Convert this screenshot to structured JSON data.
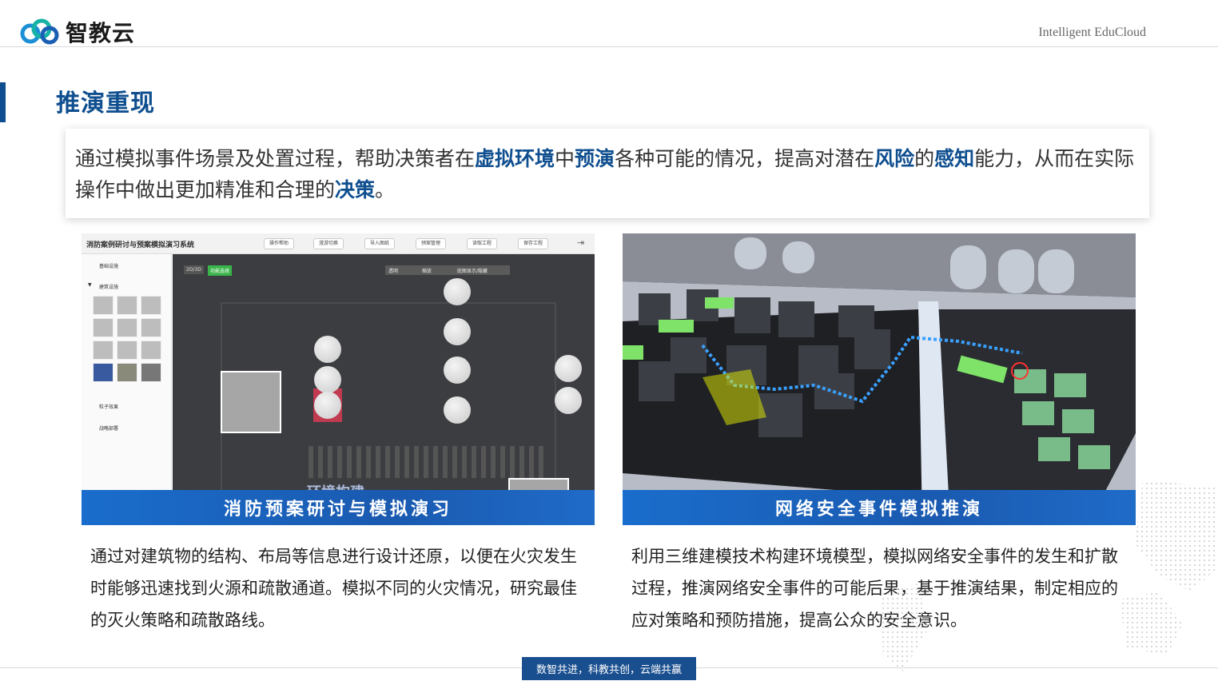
{
  "header": {
    "logo_text": "智教云",
    "tagline": "Intelligent EduCloud"
  },
  "page": {
    "title": "推演重现"
  },
  "summary": {
    "segments": [
      {
        "text": "通过模拟事件场景及处置过程，帮助决策者在",
        "bold": false
      },
      {
        "text": "虚拟环境",
        "bold": true
      },
      {
        "text": "中",
        "bold": false
      },
      {
        "text": "预演",
        "bold": true
      },
      {
        "text": "各种可能的情况，提高对潜在",
        "bold": false
      },
      {
        "text": "风险",
        "bold": true
      },
      {
        "text": "的",
        "bold": false
      },
      {
        "text": "感知",
        "bold": true
      },
      {
        "text": "能力，从而在实际操作中做出更加精准和合理的",
        "bold": false
      },
      {
        "text": "决策",
        "bold": true
      },
      {
        "text": "。",
        "bold": false
      }
    ]
  },
  "panels": [
    {
      "caption": "消防预案研讨与模拟演习",
      "description": "通过对建筑物的结构、布局等信息进行设计还原，以便在火灾发生时能够迅速找到火源和疏散通道。模拟不同的火灾情况，研究最佳的灭火策略和疏散路线。",
      "app": {
        "title": "消防案例研讨与预案模拟演习系统",
        "toolbar": [
          "操作帮助",
          "漫游切换",
          "导入图纸",
          "预案管理",
          "读取工程",
          "保存工程"
        ],
        "sidebar": [
          "基础设施",
          "建筑设施",
          "粒子效果",
          "战略部署"
        ],
        "view_toggle": "2D/3D",
        "view_active": "功能选择",
        "controls": [
          "透明",
          "缩放",
          "底图显示/隐藏"
        ],
        "overlay_label": "环境构建"
      }
    },
    {
      "caption": "网络安全事件模拟推演",
      "description": "利用三维建模技术构建环境模型，模拟网络安全事件的发生和扩散过程，推演网络安全事件的可能后果，基于推演结果，制定相应的应对策略和预防措施，提高公众的安全意识。"
    }
  ],
  "footer": {
    "slogan": "数智共进，科教共创，云端共赢"
  }
}
